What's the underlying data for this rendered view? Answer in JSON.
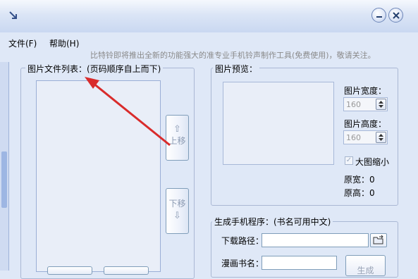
{
  "window": {
    "title_icon": "resize-arrow-icon",
    "min_icon": "minimize-icon",
    "close_icon": "close-icon"
  },
  "menu": [
    {
      "label": "文件(F)"
    },
    {
      "label": "帮助(H)"
    }
  ],
  "tagline": "比特铃即将推出全新的功能强大的准专业手机铃声制作工具(免费使用)，敬请关注。",
  "file_list": {
    "legend": "图片文件列表：(页码顺序自上而下)",
    "move_up": {
      "icon": "up-arrow-icon",
      "label": "上移"
    },
    "move_down": {
      "icon": "down-arrow-icon",
      "label": "下移"
    }
  },
  "preview": {
    "legend": "图片预览：",
    "width_label": "图片宽度：",
    "width_value": "160",
    "height_label": "图片高度：",
    "height_value": "160",
    "shrink_label": "大图缩小",
    "shrink_checked": true,
    "orig_width": "原宽：0",
    "orig_height": "原高：0"
  },
  "generate": {
    "legend": "生成手机程序：(书名可用中文)",
    "download_label": "下载路径：",
    "download_value": "",
    "book_label": "漫画书名：",
    "book_value": "",
    "generate_button": "生成"
  },
  "colors": {
    "annotation_arrow": "#d92b2b",
    "title_bar": "#d4e0f4"
  }
}
